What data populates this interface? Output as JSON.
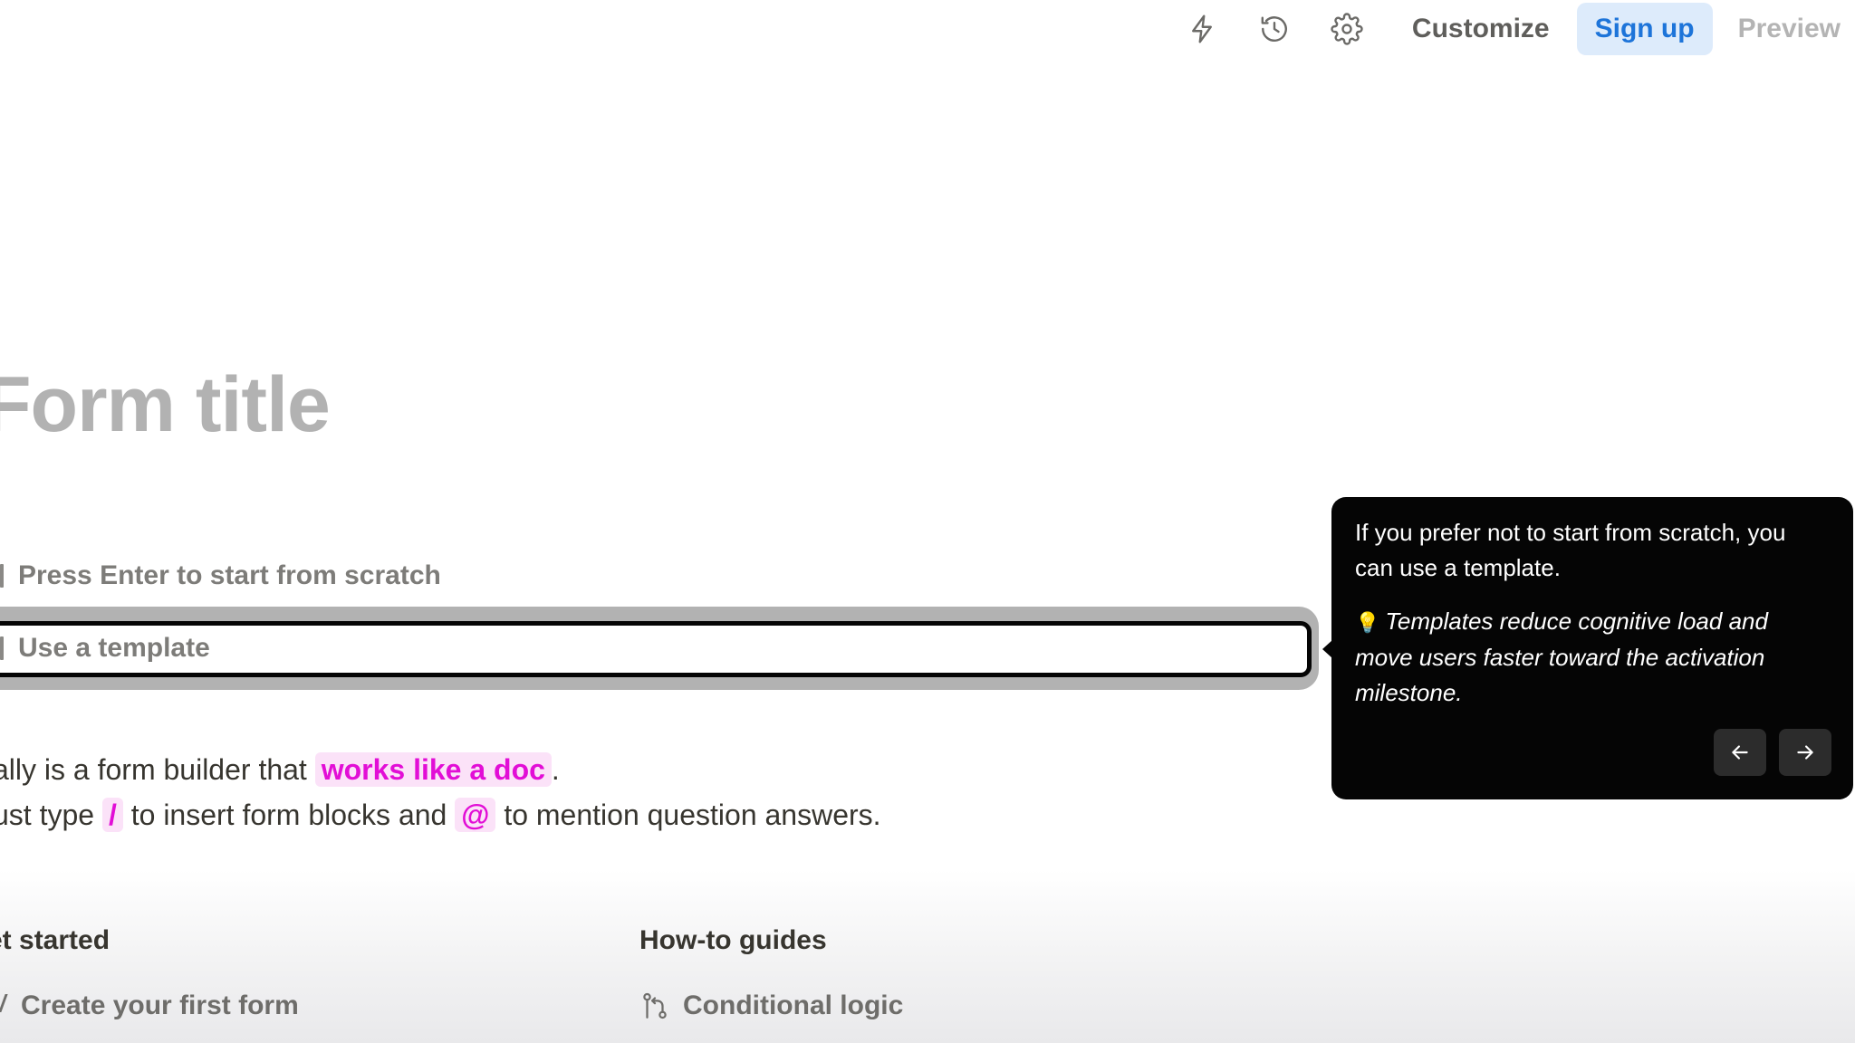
{
  "topbar": {
    "icons": [
      "lightning-icon",
      "history-icon",
      "gear-icon"
    ],
    "customize_label": "Customize",
    "signup_label": "Sign up",
    "preview_label": "Preview"
  },
  "form": {
    "title_placeholder": "Form title",
    "options": {
      "scratch_label": "Press Enter to start from scratch",
      "template_label": "Use a template"
    },
    "description": {
      "line1_prefix": "ally is a form builder that",
      "line1_highlight": "works like a doc",
      "line1_suffix": ".",
      "line2_prefix": "ust type",
      "line2_slash": "/",
      "line2_middle": "to insert form blocks and",
      "line2_at": "@",
      "line2_suffix": "to mention question answers."
    }
  },
  "sections": {
    "get_started": {
      "heading": "et started",
      "items": [
        "Create your first form"
      ]
    },
    "guides": {
      "heading": "How-to guides",
      "items": [
        "Conditional logic"
      ]
    }
  },
  "tooltip": {
    "main_text": "If you prefer not to start from scratch, you can use a template.",
    "tip_icon": "lightbulb-icon",
    "tip_text": "Templates reduce cognitive load and move users faster toward the activation milestone.",
    "nav": [
      "arrow-left-icon",
      "arrow-right-icon"
    ]
  },
  "colors": {
    "accent_pink": "#e20ed6",
    "accent_pink_bg": "#fbe2f8",
    "signup_bg": "#ddebfb",
    "signup_text": "#1d74d9",
    "tooltip_bg": "#050505"
  }
}
